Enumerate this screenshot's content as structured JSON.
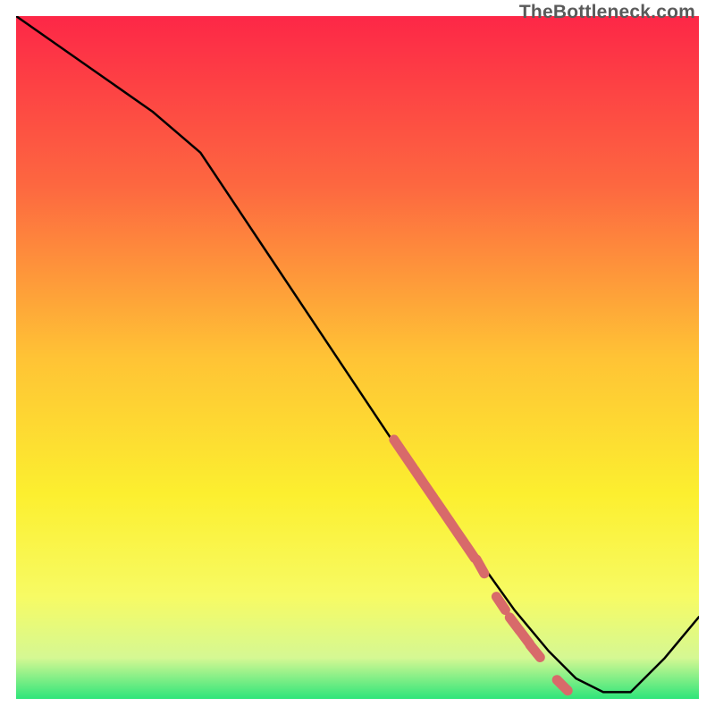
{
  "watermark": "TheBottleneck.com",
  "colors": {
    "curve": "#000000",
    "dots": "#d86a6a",
    "grad_top": "#fd2747",
    "grad_mid1": "#fd6840",
    "grad_mid2": "#ffc335",
    "grad_mid3": "#fcef2f",
    "grad_mid4": "#f7fb64",
    "grad_mid5": "#d5f893",
    "grad_bot": "#2ee57a"
  },
  "chart_data": {
    "type": "line",
    "title": "",
    "xlabel": "",
    "ylabel": "",
    "xlim": [
      0,
      100
    ],
    "ylim": [
      0,
      100
    ],
    "series": [
      {
        "name": "curve",
        "x": [
          0,
          10,
          20,
          27,
          35,
          45,
          55,
          62,
          68,
          73,
          78,
          82,
          86,
          90,
          95,
          100
        ],
        "y": [
          100,
          93,
          86,
          80,
          68,
          53,
          38,
          28,
          20,
          13,
          7,
          3,
          1,
          1,
          6,
          12
        ]
      }
    ],
    "highlight_points": {
      "name": "dots",
      "x": [
        56,
        57.5,
        59,
        60.5,
        62,
        63.5,
        65,
        66.5,
        68,
        71,
        73,
        74.5,
        76,
        80
      ],
      "y": [
        37,
        34.8,
        32.6,
        30.4,
        28.2,
        26,
        23.8,
        21.6,
        19.4,
        14,
        11,
        9,
        7,
        2
      ]
    }
  }
}
